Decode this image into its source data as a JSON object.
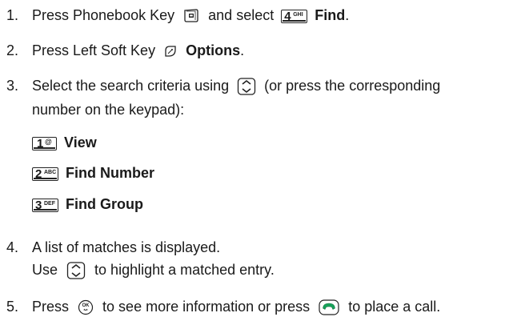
{
  "steps": [
    {
      "number": "1.",
      "parts": [
        "Press Phonebook Key",
        "and select",
        "Find",
        "."
      ],
      "icons": [
        "phonebook-key-icon",
        "key-4-ghi-icon"
      ],
      "key_labels": {
        "digit": "4",
        "letters": "GHI"
      }
    },
    {
      "number": "2.",
      "parts": [
        "Press Left Soft Key",
        "Options",
        "."
      ],
      "icons": [
        "left-soft-key-icon"
      ]
    },
    {
      "number": "3.",
      "line1_parts": [
        "Select the search criteria using",
        "(or press the corresponding"
      ],
      "line2": "number on the keypad):",
      "icons": [
        "nav-key-icon"
      ],
      "options": [
        {
          "digit": "1",
          "letters": "@",
          "label": "View"
        },
        {
          "digit": "2",
          "letters": "ABC",
          "label": "Find Number"
        },
        {
          "digit": "3",
          "letters": "DEF",
          "label": "Find Group"
        }
      ]
    },
    {
      "number": "4.",
      "line1": "A list of matches is displayed.",
      "line2_parts": [
        "Use",
        "to highlight a matched entry."
      ],
      "icons": [
        "nav-key-icon"
      ]
    },
    {
      "number": "5.",
      "parts": [
        "Press",
        "to see more information or press",
        "to place a call."
      ],
      "icons": [
        "ok-key-icon",
        "send-key-icon"
      ],
      "ok_label": "OK"
    }
  ]
}
